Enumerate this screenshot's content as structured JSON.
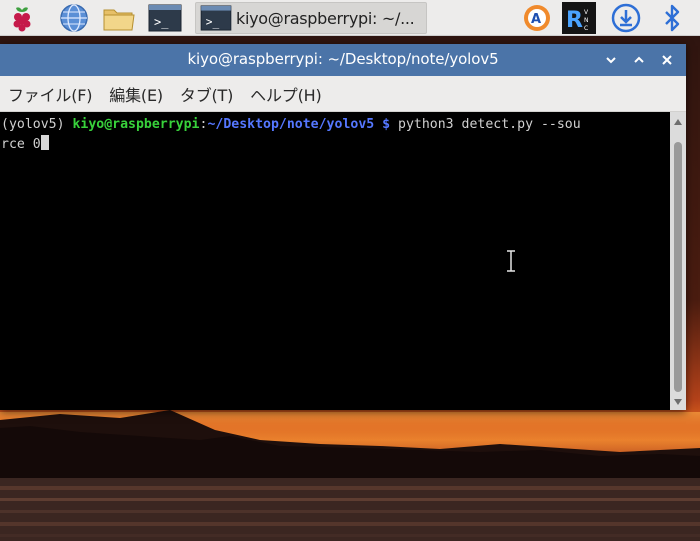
{
  "panel": {
    "task_button_label": "kiyo@raspberrypi: ~/..."
  },
  "window": {
    "title": "kiyo@raspberrypi: ~/Desktop/note/yolov5"
  },
  "menu": {
    "file": "ファイル(F)",
    "edit": "編集(E)",
    "tabs": "タブ(T)",
    "help": "ヘルプ(H)"
  },
  "terminal": {
    "env": "(yolov5) ",
    "user_host": "kiyo@raspberrypi",
    "colon": ":",
    "path": "~/Desktop/note/yolov5",
    "prompt": " $ ",
    "command_part1": "python3 detect.py --sou",
    "command_part2": "rce 0"
  },
  "colors": {
    "titlebar": "#4b74a8",
    "terminal_bg": "#000000",
    "prompt_user": "#38d13b",
    "prompt_path": "#5577ff",
    "panel_bg": "#edeceb"
  },
  "icons": [
    "raspberry-pi-menu-icon",
    "web-browser-icon",
    "file-manager-icon",
    "terminal-icon",
    "keyboard-input-icon",
    "vnc-icon",
    "updates-download-icon",
    "bluetooth-icon",
    "window-minimize-icon",
    "window-maximize-icon",
    "window-close-icon"
  ]
}
